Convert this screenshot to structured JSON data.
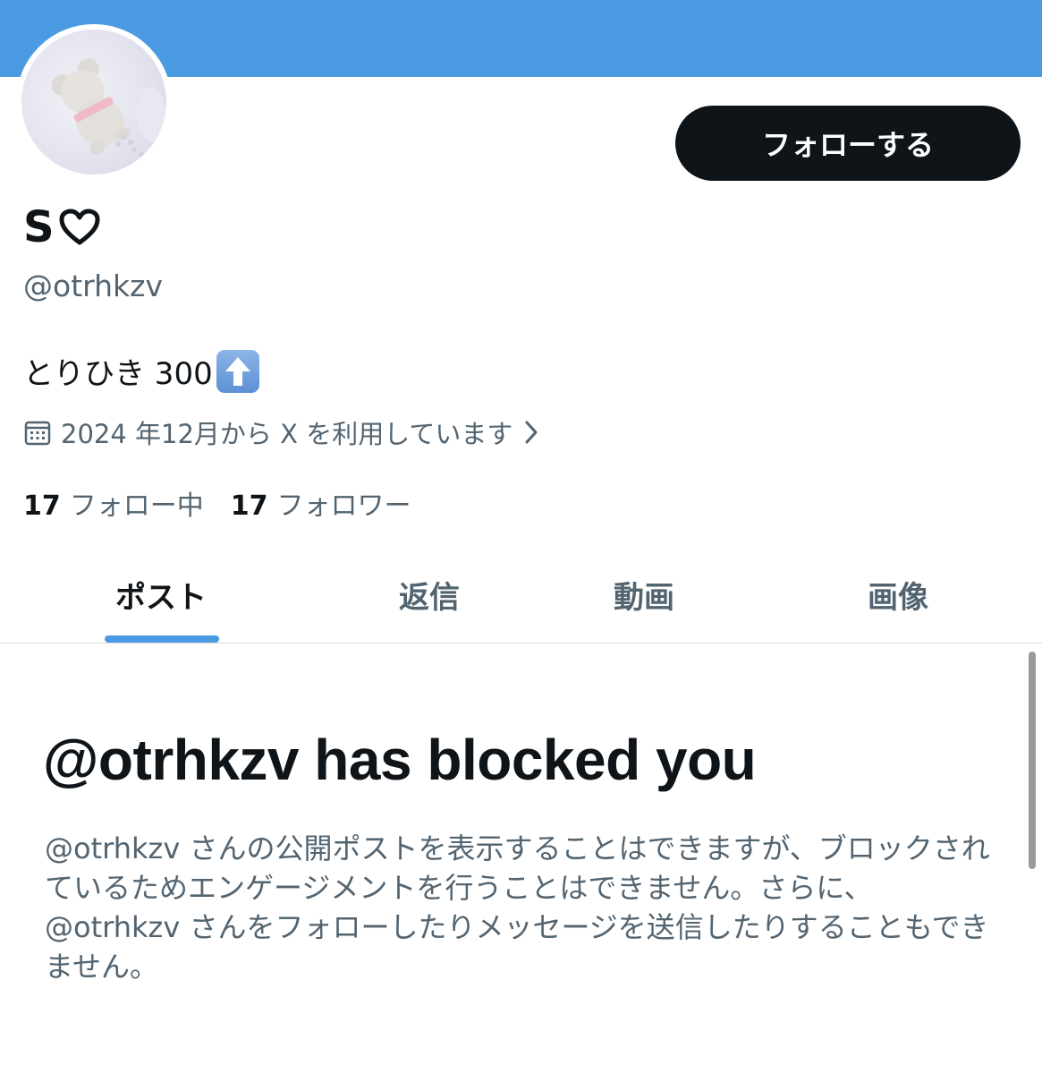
{
  "profile": {
    "display_name": "S",
    "name_icon": "heart-outline-icon",
    "handle": "@otrhkzv",
    "bio_text": "とりひき 300",
    "bio_emoji": "up-arrow-emoji-icon",
    "joined": "2024 年12月から X を利用しています",
    "following_count": "17",
    "following_label": "フォロー中",
    "followers_count": "17",
    "followers_label": "フォロワー"
  },
  "actions": {
    "follow_label": "フォローする"
  },
  "tabs": [
    {
      "label": "ポスト",
      "active": true
    },
    {
      "label": "返信",
      "active": false
    },
    {
      "label": "動画",
      "active": false
    },
    {
      "label": "画像",
      "active": false
    }
  ],
  "blocked": {
    "title": "@otrhkzv has blocked you",
    "message": "@otrhkzv さんの公開ポストを表示することはできますが、ブロックされているためエンゲージメントを行うことはできません。さらに、@otrhkzv さんをフォローしたりメッセージを送信したりすることもできません。"
  },
  "colors": {
    "banner": "#4a9be2",
    "accent": "#4a9be2",
    "button_bg": "#0f1419",
    "secondary_text": "#536471"
  }
}
